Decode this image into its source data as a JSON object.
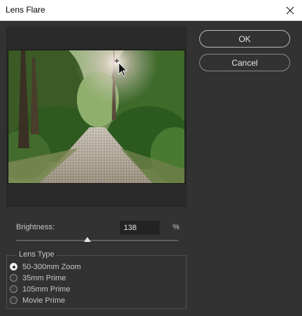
{
  "window": {
    "title": "Lens Flare"
  },
  "buttons": {
    "ok_label": "OK",
    "cancel_label": "Cancel"
  },
  "brightness": {
    "label": "Brightness:",
    "value": "138",
    "unit": "%",
    "slider_fraction": 0.44
  },
  "lens_type": {
    "legend": "Lens Type",
    "options": [
      {
        "label": "50-300mm Zoom",
        "checked": true
      },
      {
        "label": "35mm Prime",
        "checked": false
      },
      {
        "label": "105mm Prime",
        "checked": false
      },
      {
        "label": "Movie Prime",
        "checked": false
      }
    ]
  },
  "icons": {
    "close": "close-icon",
    "flare_center": "crosshair-icon",
    "pointer": "mouse-pointer-icon"
  },
  "colors": {
    "dialog_bg": "#323232",
    "titlebar_bg": "#ffffff",
    "text": "#c7c7c7"
  }
}
